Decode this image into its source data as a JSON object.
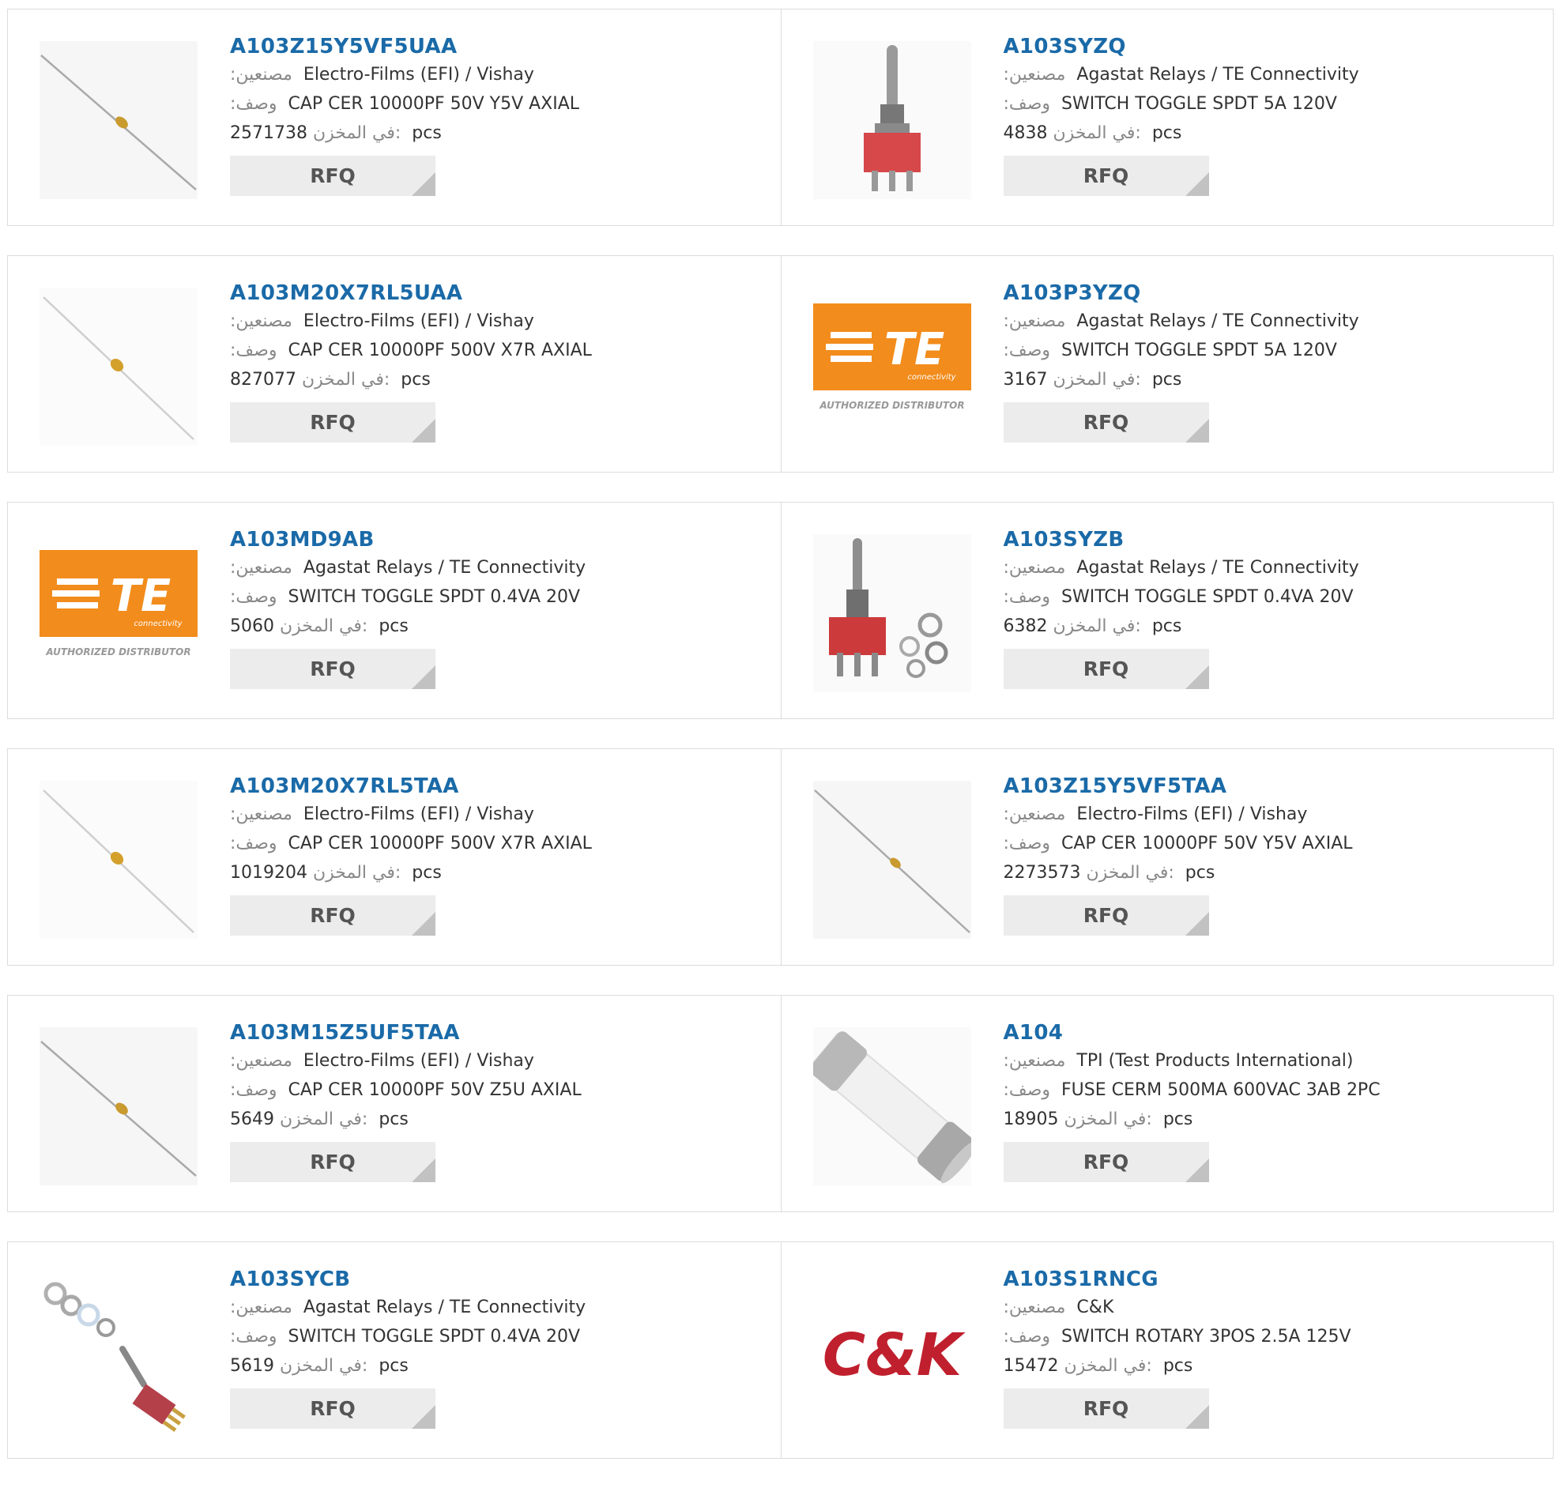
{
  "labels": {
    "manufacturer": ":مصنعين",
    "description": ":وصف",
    "stock": "في المخزن:",
    "unit": "pcs",
    "rfq": "RFQ"
  },
  "products": [
    {
      "pn": "A103Z15Y5VF5UAA",
      "mfr": "Electro-Films (EFI) / Vishay",
      "desc": "CAP CER 10000PF 50V Y5V AXIAL",
      "stock": "2571738",
      "image": "axial-capacitor-icon"
    },
    {
      "pn": "A103SYZQ",
      "mfr": "Agastat Relays / TE Connectivity",
      "desc": "SWITCH TOGGLE SPDT 5A 120V",
      "stock": "4838",
      "image": "toggle-switch-icon"
    },
    {
      "pn": "A103M20X7RL5UAA",
      "mfr": "Electro-Films (EFI) / Vishay",
      "desc": "CAP CER 10000PF 500V X7R AXIAL",
      "stock": "827077",
      "image": "axial-capacitor-icon"
    },
    {
      "pn": "A103P3YZQ",
      "mfr": "Agastat Relays / TE Connectivity",
      "desc": "SWITCH TOGGLE SPDT 5A 120V",
      "stock": "3167",
      "image": "te-logo",
      "logo_text": "TE",
      "logo_sub": "connectivity",
      "logo_caption": "AUTHORIZED DISTRIBUTOR"
    },
    {
      "pn": "A103MD9AB",
      "mfr": "Agastat Relays / TE Connectivity",
      "desc": "SWITCH TOGGLE SPDT 0.4VA 20V",
      "stock": "5060",
      "image": "te-logo",
      "logo_text": "TE",
      "logo_sub": "connectivity",
      "logo_caption": "AUTHORIZED DISTRIBUTOR"
    },
    {
      "pn": "A103SYZB",
      "mfr": "Agastat Relays / TE Connectivity",
      "desc": "SWITCH TOGGLE SPDT 0.4VA 20V",
      "stock": "6382",
      "image": "toggle-switch-with-nuts-icon"
    },
    {
      "pn": "A103M20X7RL5TAA",
      "mfr": "Electro-Films (EFI) / Vishay",
      "desc": "CAP CER 10000PF 500V X7R AXIAL",
      "stock": "1019204",
      "image": "axial-capacitor-icon"
    },
    {
      "pn": "A103Z15Y5VF5TAA",
      "mfr": "Electro-Films (EFI) / Vishay",
      "desc": "CAP CER 10000PF 50V Y5V AXIAL",
      "stock": "2273573",
      "image": "axial-capacitor-icon"
    },
    {
      "pn": "A103M15Z5UF5TAA",
      "mfr": "Electro-Films (EFI) / Vishay",
      "desc": "CAP CER 10000PF 50V Z5U AXIAL",
      "stock": "5649",
      "image": "axial-capacitor-icon"
    },
    {
      "pn": "A104",
      "mfr": "TPI (Test Products International)",
      "desc": "FUSE CERM 500MA 600VAC 3AB 2PC",
      "stock": "18905",
      "image": "cartridge-fuse-icon"
    },
    {
      "pn": "A103SYCB",
      "mfr": "Agastat Relays / TE Connectivity",
      "desc": "SWITCH TOGGLE SPDT 0.4VA 20V",
      "stock": "5619",
      "image": "toggle-switch-angled-icon"
    },
    {
      "pn": "A103S1RNCG",
      "mfr": "C&K",
      "desc": "SWITCH ROTARY 3POS 2.5A 125V",
      "stock": "15472",
      "image": "ck-logo",
      "logo_text": "C&K"
    }
  ],
  "colors": {
    "link": "#1a6aa8",
    "te_orange": "#f28c1c",
    "ck_red": "#c0202e",
    "rfq_bg": "#ececec"
  }
}
